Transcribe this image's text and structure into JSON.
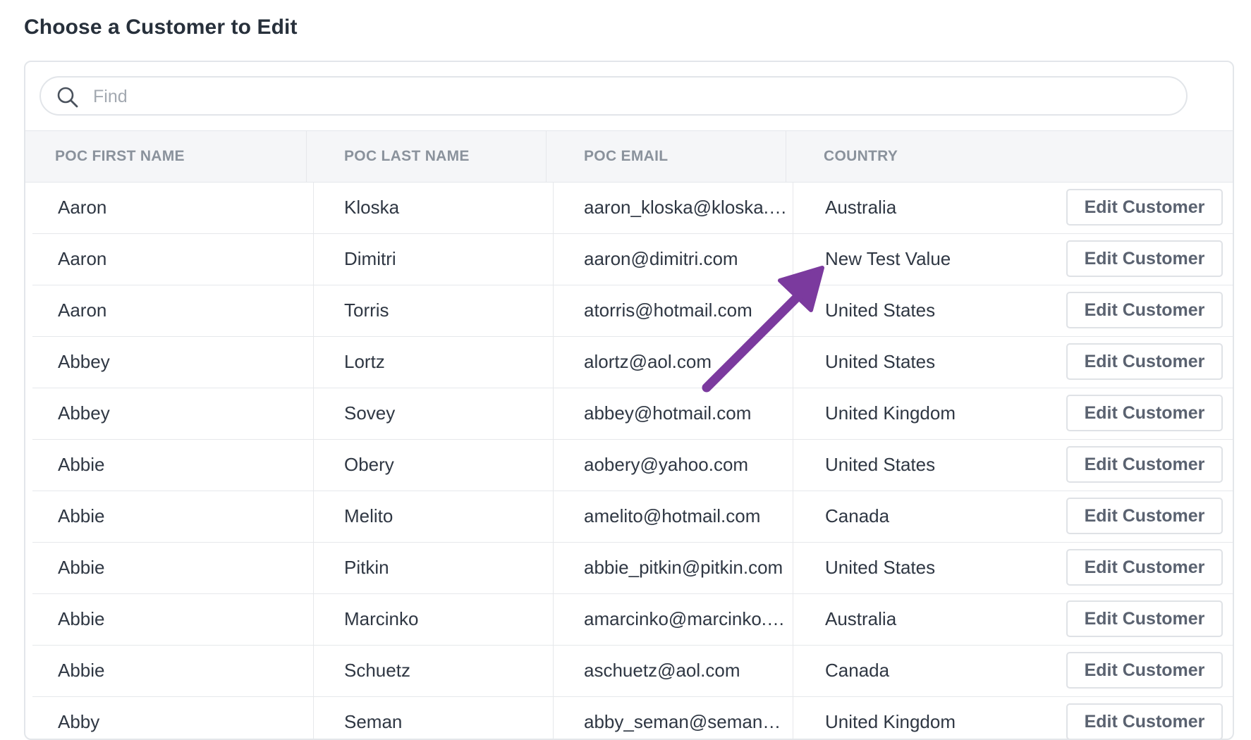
{
  "page_title": "Choose a Customer to Edit",
  "search": {
    "placeholder": "Find",
    "value": "",
    "icon": "search-icon"
  },
  "columns": [
    "POC FIRST NAME",
    "POC LAST NAME",
    "POC EMAIL",
    "COUNTRY"
  ],
  "action_label": "Edit Customer",
  "rows": [
    {
      "first": "Aaron",
      "last": "Kloska",
      "email": "aaron_kloska@kloska.…",
      "country": "Australia"
    },
    {
      "first": "Aaron",
      "last": "Dimitri",
      "email": "aaron@dimitri.com",
      "country": "New Test Value"
    },
    {
      "first": "Aaron",
      "last": "Torris",
      "email": "atorris@hotmail.com",
      "country": "United States"
    },
    {
      "first": "Abbey",
      "last": "Lortz",
      "email": "alortz@aol.com",
      "country": "United States"
    },
    {
      "first": "Abbey",
      "last": "Sovey",
      "email": "abbey@hotmail.com",
      "country": "United Kingdom"
    },
    {
      "first": "Abbie",
      "last": "Obery",
      "email": "aobery@yahoo.com",
      "country": "United States"
    },
    {
      "first": "Abbie",
      "last": "Melito",
      "email": "amelito@hotmail.com",
      "country": "Canada"
    },
    {
      "first": "Abbie",
      "last": "Pitkin",
      "email": "abbie_pitkin@pitkin.com",
      "country": "United States"
    },
    {
      "first": "Abbie",
      "last": "Marcinko",
      "email": "amarcinko@marcinko.…",
      "country": "Australia"
    },
    {
      "first": "Abbie",
      "last": "Schuetz",
      "email": "aschuetz@aol.com",
      "country": "Canada"
    },
    {
      "first": "Abby",
      "last": "Seman",
      "email": "abby_seman@seman…",
      "country": "United Kingdom"
    }
  ],
  "annotation": {
    "arrow_color": "#7b3a9e",
    "points_to": "New Test Value"
  }
}
